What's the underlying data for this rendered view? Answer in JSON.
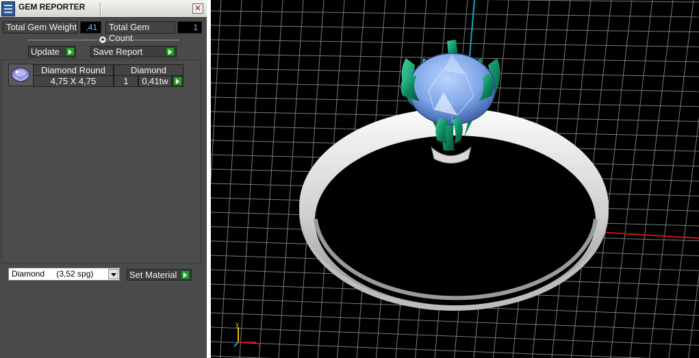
{
  "window": {
    "title": "GEM REPORTER",
    "close_glyph": "✕"
  },
  "stats": {
    "weight_label": "Total Gem Weight",
    "weight_value": ",41",
    "count_label": "Total Gem Count",
    "count_value": "1"
  },
  "actions": {
    "update_label": "Update",
    "save_label": "Save Report"
  },
  "gem_list": {
    "row": {
      "name": "Diamond Round",
      "material": "Diamond",
      "size": "4,75 X 4,75",
      "count": "1",
      "weight": "0,41tw"
    }
  },
  "material_select": {
    "name": "Diamond",
    "density": "(3,52 spg)",
    "set_label": "Set Material"
  },
  "viewport": {
    "axis_x_label": "x",
    "axis_y_label": "y",
    "colors": {
      "gem": "#7fa6e8",
      "prongs": "#0e8a63",
      "metal": "#d6d6d6",
      "x_axis": "#cc1111",
      "z_axis": "#18a6c4"
    }
  }
}
